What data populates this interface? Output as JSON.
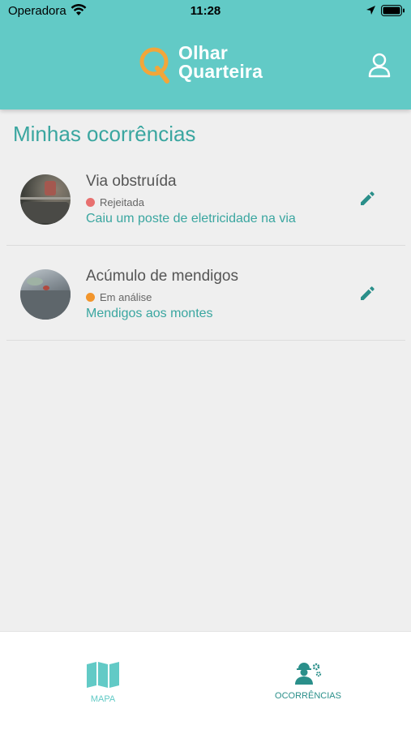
{
  "status_bar": {
    "carrier": "Operadora",
    "time": "11:28"
  },
  "header": {
    "logo_line1": "Olhar",
    "logo_line2": "Quarteira"
  },
  "page_title": "Minhas ocorrências",
  "occurrences": [
    {
      "title": "Via obstruída",
      "status": "Rejeitada",
      "status_color": "#e8706f",
      "description": "Caiu um poste de eletricidade na via"
    },
    {
      "title": "Acúmulo de mendigos",
      "status": "Em análise",
      "status_color": "#f2952c",
      "description": "Mendigos aos montes"
    }
  ],
  "tabs": [
    {
      "label": "MAPA",
      "icon": "map-icon"
    },
    {
      "label": "OCORRÊNCIAS",
      "icon": "worker-gear-icon",
      "active": true
    }
  ],
  "colors": {
    "brand": "#62cac6",
    "accent_text": "#3aa6a0",
    "logo_mark": "#f2a63a"
  }
}
